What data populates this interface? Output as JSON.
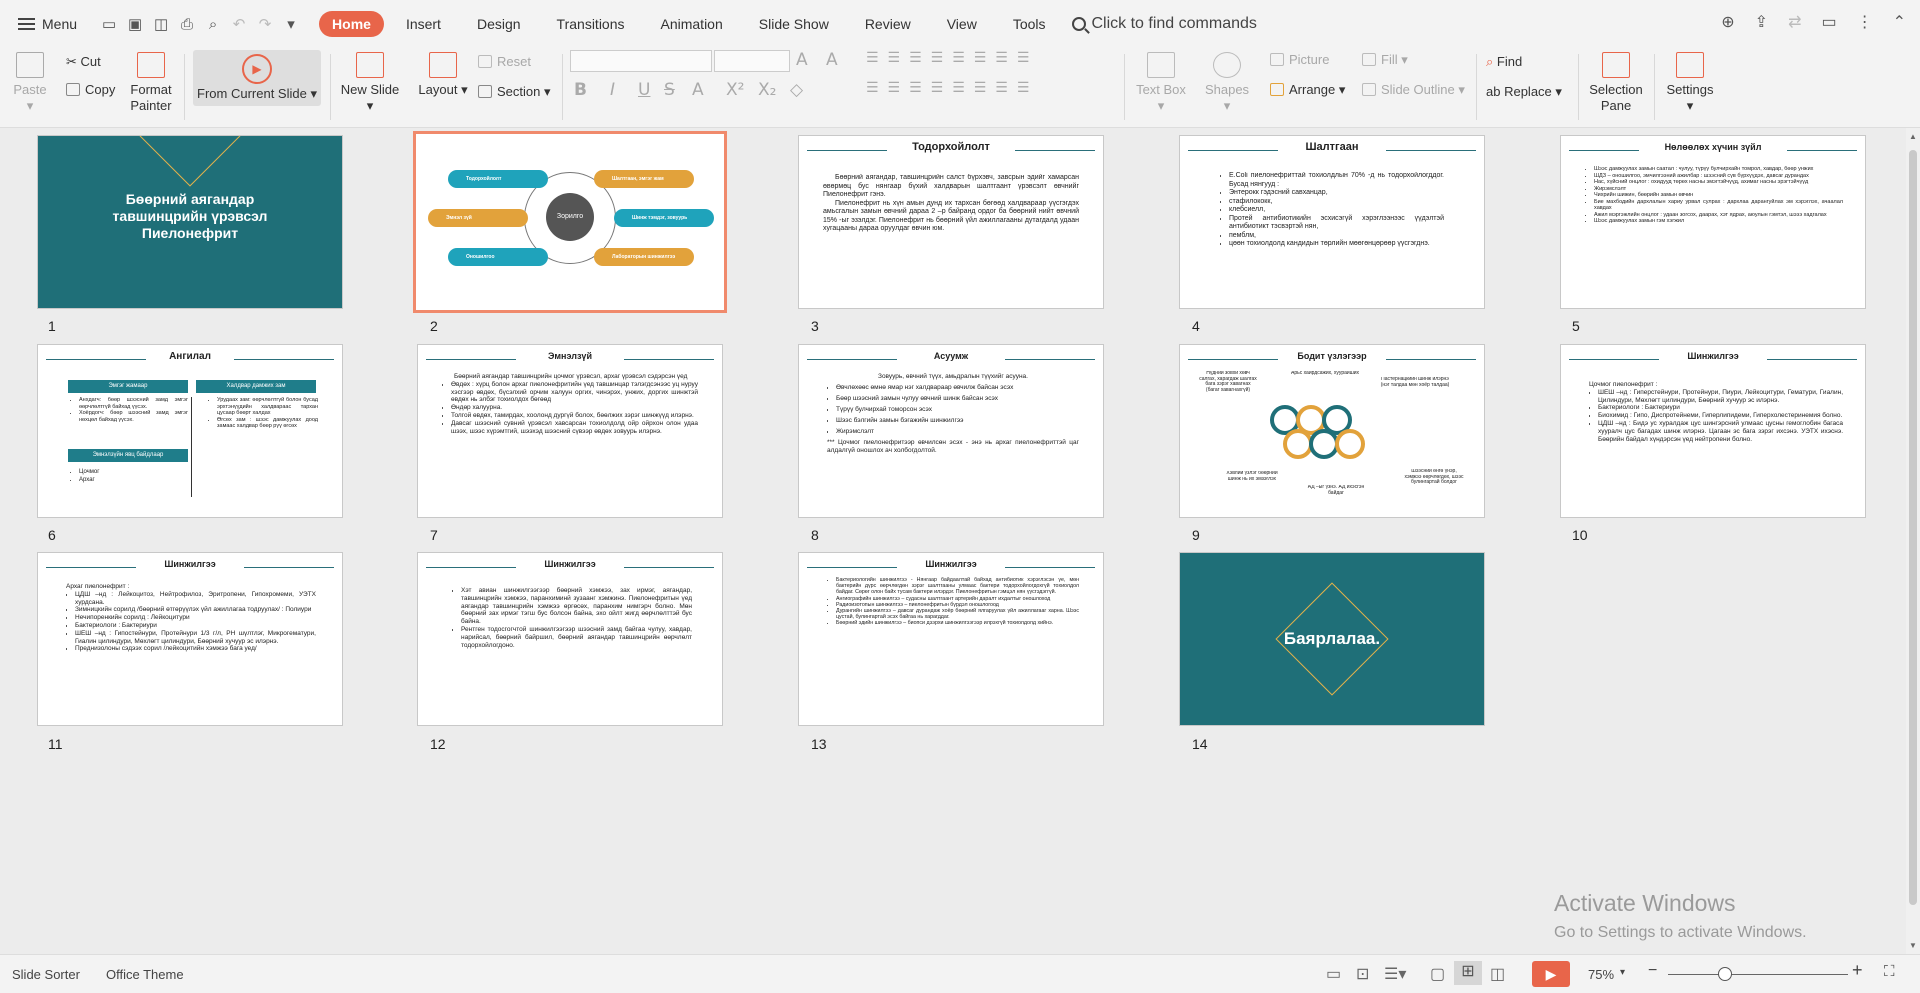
{
  "topbar": {
    "menu_label": "Menu",
    "tabs": [
      "Home",
      "Insert",
      "Design",
      "Transitions",
      "Animation",
      "Slide Show",
      "Review",
      "View",
      "Tools"
    ],
    "active_tab": "Home",
    "search_placeholder": "Click to find commands"
  },
  "ribbon": {
    "paste": "Paste",
    "cut": "Cut",
    "copy": "Copy",
    "format_painter": "Format Painter",
    "from_current_slide": "From Current Slide",
    "new_slide": "New Slide",
    "layout": "Layout",
    "reset": "Reset",
    "section": "Section",
    "text_box": "Text Box",
    "shapes": "Shapes",
    "picture": "Picture",
    "fill": "Fill",
    "arrange": "Arrange",
    "slide_outline": "Slide Outline",
    "find": "Find",
    "replace": "Replace",
    "selection_pane": "Selection Pane",
    "settings": "Settings",
    "format_buttons": [
      "B",
      "I",
      "U",
      "S",
      "A",
      "X²",
      "X₂"
    ]
  },
  "slides": [
    {
      "num": "1",
      "title": "Бөөрний аягандар тавшинцрийн үрэвсэл Пиелонефрит"
    },
    {
      "num": "2",
      "center": "Зорилго",
      "items": [
        "Тодорхойлолт",
        "Шалтгаан, эмгэг жам",
        "Эмнэл зүй",
        "Шинж тэмдэг, зовуурь",
        "Оношилгоо",
        "Лабораторын шинжилгээ"
      ]
    },
    {
      "num": "3",
      "title": "Тодорхойлолт",
      "paragraphs": [
        "Бөөрний аягандар, тавшинцрийн салст бүрхэвч, завсрын эдийг хамарсан өвөрмөц бус нянгаар бүхий халдварын шалтгаант үрэвсэлт өвчнийг Пиелонефрит гэнэ.",
        "Пиелонефрит нь хүн амын дунд их тархсан бөгөөд халдвараар үүсгэгдэх амьсгалын замын өвчний дараа 2 –р байранд ордог ба бөөрний нийт өвчний 15% -ыг эзэлдэг. Пиелонефрит нь бөөрний үйл ажиллагааны дутагдалд удаан хугацааны дараа оруулдаг өвчин юм."
      ]
    },
    {
      "num": "4",
      "title": "Шалтгаан",
      "bullets": [
        "E.Coli пиелонефриттай тохиолдлын 70% -д нь тодорхойлогддог. Бусад нянгууд :",
        "Энтерокк гэдэсний савханцар,",
        "стафилококк,",
        "клебсиелл,",
        "Протей антибиотикийн эсхисэгүй хэрэглээнээс үүдэлтэй антибиотикт тэсвэртэй нян,",
        "пемблм,",
        "цөөн тохиолдолд кандидын төрлийн мөөгөнцөрөөр үүсгэгднэ."
      ]
    },
    {
      "num": "5",
      "title": "Нөлөөлөх хүчин зүйл",
      "bullets": [
        "Шээс дамжуулах замын саатал : чулуу, түрүү булчирхайн томрол, хавдар, бөөр унжих",
        "ШДЗ – оношилгоо, эмчилгээний ажилбар : шээсний сүв бүрхүүдэх, давсаг дурандах",
        "Нас, хүйсний онцлог : охидууд төрөх насны эмэгтэйчүүд, ахимаг насны эрэгтэйчүүд",
        "Жирэмслэлт",
        "Чихрийн шижин, бөөрийн замын өвчин",
        "Бие махбодийн дархлалын хариу урвал сулрах : дархлаа дарангуйлах эм хэрэглэх, ачаалал хавдах",
        "Ажил мэргэжлийн онцлог : удаан зогсох, даарах, хэт ядрах, аюулын гэмтэл, шэээ хадгалах",
        "Шээс дамжуулах замын гэм хэгжил"
      ]
    },
    {
      "num": "6",
      "title": "Ангилал",
      "h1": "Эмгэг жамаар",
      "h2": "Халдвар дамжих зам",
      "h3": "Эмнэлзүйн явц байдлаар",
      "c1": [
        "Анхдагч: бөөр шээсний замд эмгэг өөрчлөлтгүй байхад үүсэх.",
        "Хоёрдогч: бөөр шээсний замд эмгэг нөхцөл байхад үүсэх."
      ],
      "c2": [
        "Урудаах зам: өөрчлөлтгүй болон бусад эрхтэнүүдийн халдвараас тархан цусаар бөөрт халдах",
        "Өгсөх зам : шээс дамжуулах доод замаас халдвар бөөр рүү өгсөх"
      ],
      "c3": [
        "Цочмог",
        "Архаг"
      ]
    },
    {
      "num": "7",
      "title": "Эмнэлзүй",
      "intro": "Бөөрний аягандар тавшинцрийн цочмог үрэвсэл, архаг үрэвсэл сэдэрсэн үед",
      "bullets": [
        "Өвдөх : хүрц болон архаг пиелонефритийн үед тавшинцар тэлэгдсэнээс уц нуруу хэсгээр өвдөх, бүсэлхий орчим халуун оргих, чинэрэх, унжих, доргих шинжтэй өвдөх нь элбэг тохиолдох бөгөөд",
        "Өндөр халуурна.",
        "Толгой өвдөх, тамирдах, хоолонд дургүй болох, бөөлжих зэрэг шинжүүд илэрнэ.",
        "Давсаг шээсний сувний үрэвсэл хавсарсан тохиолдолд ойр ойрхон олон удаа шээх, шээс хүрэмтгий, шээхэд шээсний сүвээр өвдөх зовуурь илэрнэ."
      ]
    },
    {
      "num": "8",
      "title": "Асуумж",
      "intro": "Зовуурь, өвчний түүх, амьдралын түүхийг асууна.",
      "bullets": [
        "Өвчлөхөөс өмнө ямар нэг халдвараар өвчилж байсан эсэх",
        "Бөөр шээсний замын чулуу өвчний шинж байсан эсэх",
        "Түрүү булчирхай томорсон эсэх",
        "Шээс бэлгийн замын бэгажийн шинжилгээ",
        "Жирэмслэлт"
      ],
      "note": "*** Цочмог пиелонефритээр өвчилсөн эсэх - энэ нь архаг пиелонефриттэй цаг алдалгүй оношлох ач холбогдолтой."
    },
    {
      "num": "9",
      "title": "Бодит үзлэгээр",
      "labels": [
        "Нүдний зовхи хөвч салгах, харагдаж шалгах бага зэрэг хавагнах (багаг хавагнахгүй)",
        "Арьс хайрдсажих, хуурайших",
        "Пастернацкийн шинж илэрнэ (нэг талдаа мөн хоёр талдаа)",
        "Хэвлий үзлэг бөөрний шинж нь их эмзэглэх",
        "АД –ыг үзнэ. АД ихэсгэн байдаг",
        "Шээсний өнгө үнэр, хэмжээ өөрчлөгдөх, шээс булингартай болдог"
      ]
    },
    {
      "num": "10",
      "title": "Шинжилгээ",
      "intro": "Цочмог пиелонефрит :",
      "bullets": [
        "ШЕШ –нд : Гиперстейнури, Протейнури, Пиури, Лейкоцитури, Гематури, Гиалин, Цилиндури, Мөхлөгт цилиндури, Бөөрний хучуур эс илэрнэ.",
        "Бактериологи : Бактериури",
        "Биохимид : Гипо, Диспротейнеми, Гиперлипидеми, Гиперхолестеринемия болно.",
        "ЦДШ –нд : Бидэ ус хуралдаж цус шингэрсний улмаас цусны гемоглобин багаса хууралч цус багадах шинж илэрнэ. Цагаан эс бага зэрэг ихсэнэ. УЭТХ ихэснэ. Бөөрийн байдал хүндэрсэн үед нейтропени болно."
      ]
    },
    {
      "num": "11",
      "title": "Шинжилгээ",
      "intro": "Архаг пиелонефрит :",
      "bullets": [
        "ЦДШ –нд : Лейкоцитоз, Нейтрофилоз, Эритропени, Гипохромеми, УЭТХ хурдсана.",
        "Зимницкийн сорилд /бөөрний өтгөрүүлэх үйл ажиллагаа тодруулах/ : Полиури",
        "Нечипоренкийн сорилд : Лейкоцитури",
        "Бактериологи : Бактериури",
        "ШЕШ –нд : Гипостейнури, Протейнури 1/3 г/л, PH шүлтлэг, Микрогематури, Гиалин цилиндури, Мөхлөгт цилиндури, Бөөрний хучуур эс илэрнэ.",
        "Преднизолоны сэдээх сорил /лейкоцитийн хэмжээ бага уед/"
      ]
    },
    {
      "num": "12",
      "title": "Шинжилгээ",
      "bullets": [
        "Хэт авиан шинжилгээгээр бөөрний хэмжээ, зах ирмэг, аягандар, тавшинцрийн хэмжээ, паранхиминй зузаанг хэмжинэ. Пиелонефритын үед аягандар тавшинцрийн хэмжээ өргөсөх, паранхим нимгэрч болно. Мөн бөөрний зах ирмэг тэгш бус болсон байна, эхо ойлт жигд өөрчлөлттэй бус байна.",
        "Рентген тодосгогчтой шинжилгээгээр шээсний замд байгаа чулуу, хавдар, нарийсал, бөөрний байршил, бөөрний аягандар тавшинцрийн өөрчлөлт тодорхойлогдоно."
      ]
    },
    {
      "num": "13",
      "title": "Шинжилгээ",
      "bullets": [
        "Бактериологийн шинжилгээ - Нянгаар байдаалтай байхад антибиотик хэрэглэсэн үе, мөн бактерийн дүрс өөрчлөгдөн зэрэг шалтгааны улмаас бактери тодорхойлогдохгүй тохиолдол байдаг. Сөрөг олон байх тусам бактери илэрдэг. Пиелонефритын гэмцэл нян үүсгэдэггүй.",
        "Ангиографийн шинжилгээ – судасны шалтгаант артерийн даралт ихдалтыг оношлоход",
        "Радиоизотопын шинжилгээ – пиелонефритын бүрдэл оношлогоод",
        "Дурангийн шинжилгээ – давсаг дурандаж хоёр бөөрний ялгаруулах үйл ажиллагааг харна. Шээс цустай, булингартай эсэх байгаа нь харагддаг.",
        "Бөөрний эдийн шинжилгээ – биопси дээрхи шинжилгээгээр илрэхгүй тохиолдолд хийнэ."
      ]
    },
    {
      "num": "14",
      "title": "Баярлалаа."
    }
  ],
  "status": {
    "view": "Slide Sorter",
    "theme": "Office Theme",
    "zoom": "75%",
    "watermark_title": "Activate Windows",
    "watermark_sub": "Go to Settings to activate Windows."
  }
}
